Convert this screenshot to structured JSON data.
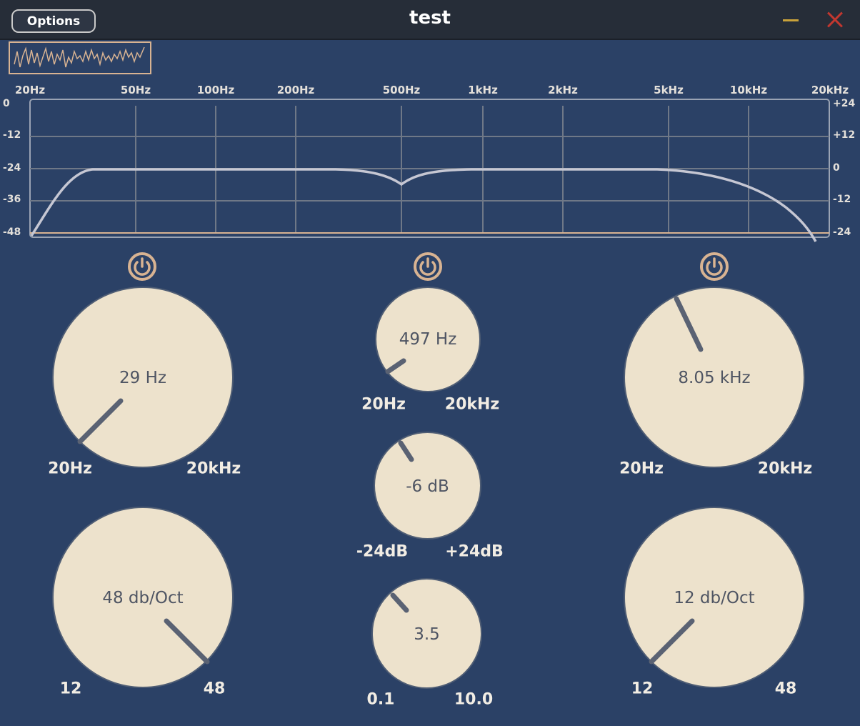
{
  "titlebar": {
    "options_label": "Options",
    "title": "test",
    "minimize_color": "#c9a23a",
    "close_color": "#c1372f"
  },
  "display": {
    "freq_labels": [
      "20Hz",
      "50Hz",
      "100Hz",
      "200Hz",
      "500Hz",
      "1kHz",
      "2kHz",
      "5kHz",
      "10kHz",
      "20kHz"
    ],
    "db_left": [
      "0",
      "-12",
      "-24",
      "-36",
      "-48"
    ],
    "db_right": [
      "+24",
      "+12",
      "0",
      "-12",
      "-24"
    ]
  },
  "low_cut": {
    "enabled": true,
    "freq": {
      "value": "29 Hz",
      "min": "20Hz",
      "max": "20kHz"
    },
    "slope": {
      "value": "48 db/Oct",
      "min": "12",
      "max": "48"
    }
  },
  "peak": {
    "enabled": true,
    "freq": {
      "value": "497 Hz",
      "min": "20Hz",
      "max": "20kHz"
    },
    "gain": {
      "value": "-6 dB",
      "min": "-24dB",
      "max": "+24dB"
    },
    "quality": {
      "value": "3.5",
      "min": "0.1",
      "max": "10.0"
    }
  },
  "high_cut": {
    "enabled": true,
    "freq": {
      "value": "8.05 kHz",
      "min": "20Hz",
      "max": "20kHz"
    },
    "slope": {
      "value": "12 db/Oct",
      "min": "12",
      "max": "48"
    }
  },
  "colors": {
    "background": "#2b4166",
    "knob_fill": "#ede2cc",
    "knob_pointer": "#5a6273",
    "accent": "#d8b392",
    "curve": "#c6c7d3"
  }
}
